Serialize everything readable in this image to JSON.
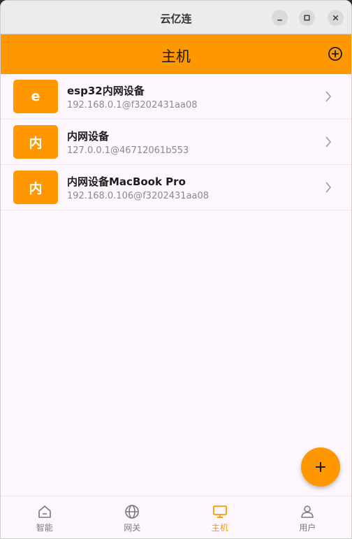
{
  "window": {
    "title": "云亿连"
  },
  "appbar": {
    "title": "主机"
  },
  "hosts": [
    {
      "avatar": "e",
      "name": "esp32内网设备",
      "address": "192.168.0.1@f3202431aa08"
    },
    {
      "avatar": "内",
      "name": "内网设备",
      "address": "127.0.0.1@46712061b553"
    },
    {
      "avatar": "内",
      "name": "内网设备MacBook Pro",
      "address": "192.168.0.106@f3202431aa08"
    }
  ],
  "nav": [
    {
      "label": "智能",
      "icon": "home-icon",
      "active": false
    },
    {
      "label": "网关",
      "icon": "globe-icon",
      "active": false
    },
    {
      "label": "主机",
      "icon": "monitor-icon",
      "active": true
    },
    {
      "label": "用户",
      "icon": "user-icon",
      "active": false
    }
  ],
  "colors": {
    "accent": "#ff9800",
    "background": "#fdf7fd",
    "inactive": "#7a7a7a"
  }
}
